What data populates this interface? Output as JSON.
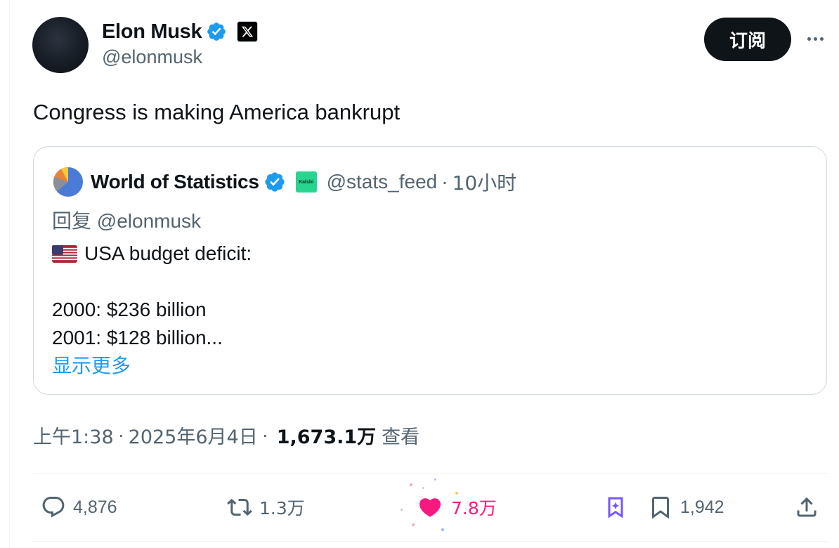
{
  "author": {
    "display_name": "Elon Musk",
    "handle": "@elonmusk",
    "verified": true,
    "affiliate_badge_icon": "x-logo-icon"
  },
  "header": {
    "subscribe_label": "订阅",
    "more_icon": "more-horizontal-icon"
  },
  "tweet": {
    "text": "Congress is making America bankrupt"
  },
  "quoted_tweet": {
    "display_name": "World of Statistics",
    "handle": "@stats_feed",
    "separator": "·",
    "time_ago": "10小时",
    "verified": true,
    "affiliate_badge_text": "Kalshi",
    "reply_prefix": "回复",
    "reply_to": "@elonmusk",
    "headline": "USA budget deficit:",
    "lines": [
      "2000: $236 billion",
      "2001: $128 billion..."
    ],
    "show_more_label": "显示更多"
  },
  "meta": {
    "time": "上午1:38",
    "separator": "·",
    "date": "2025年6月4日",
    "views_count": "1,673.1万",
    "views_label": "查看"
  },
  "actions": {
    "replies": "4,876",
    "reposts": "1.3万",
    "likes": "7.8万",
    "bookmarks": "1,942"
  },
  "colors": {
    "accent_blue": "#1d9bf0",
    "like_pink": "#f91880",
    "text_primary": "#0f1419",
    "text_secondary": "#536471",
    "grok_purple": "#7856ff"
  }
}
